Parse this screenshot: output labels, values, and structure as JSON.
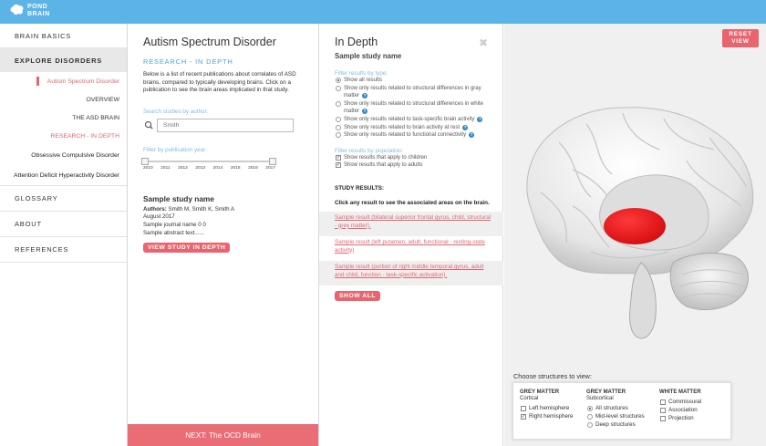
{
  "brand": {
    "logo_line1": "POND",
    "logo_line2": "BRAIN"
  },
  "sidebar": {
    "items": [
      {
        "label": "BRAIN BASICS"
      },
      {
        "label": "EXPLORE DISORDERS"
      }
    ],
    "sub_items": [
      {
        "label": "Autism Spectrum Disorder"
      },
      {
        "label": "OVERVIEW"
      },
      {
        "label": "THE ASD BRAIN"
      },
      {
        "label": "RESEARCH - IN DEPTH"
      }
    ],
    "disorders": [
      {
        "label": "Obsessive Compulsive Disorder"
      },
      {
        "label": "Attention Deficit Hyperactivity Disorder"
      }
    ],
    "bottom_items": [
      {
        "label": "GLOSSARY"
      },
      {
        "label": "ABOUT"
      },
      {
        "label": "REFERENCES"
      }
    ]
  },
  "research": {
    "title": "Autism Spectrum Disorder",
    "subtitle": "RESEARCH - IN DEPTH",
    "description": "Below is a list of recent publications about correlates of ASD brains, compared to typically developing brains. Click on a publication to see the brain areas implicated in that study.",
    "search_label": "Search studies by author:",
    "search_value": "Smith",
    "year_label": "Filter by publication year:",
    "years": [
      "2010",
      "2011",
      "2012",
      "2013",
      "2014",
      "2015",
      "2016",
      "2017"
    ],
    "year_range": [
      "2010",
      "2017"
    ],
    "study": {
      "title": "Sample study name",
      "authors_label": "Authors:",
      "authors": "Smith M, Smith K, Smith A",
      "date": "August 2017",
      "journal": "Sample journal name 0 0",
      "abstract": "Sample abstract text......",
      "button": "VIEW STUDY IN DEPTH"
    },
    "next_label": "NEXT: The OCD Brain"
  },
  "in_depth": {
    "title": "In Depth",
    "close_glyph": "✖",
    "study_name": "Sample study name",
    "filter_type_label": "Filter results by type:",
    "type_options": [
      {
        "label": "Show all results",
        "selected": true,
        "help": false
      },
      {
        "label": "Show only results related to structural differences in gray matter",
        "selected": false,
        "help": true
      },
      {
        "label": "Show only results related to structural differences in white matter",
        "selected": false,
        "help": true
      },
      {
        "label": "Show only results related to task-specific brain activity",
        "selected": false,
        "help": true
      },
      {
        "label": "Show only results related to brain activity at rest",
        "selected": false,
        "help": true
      },
      {
        "label": "Show only results related to functional connectivity",
        "selected": false,
        "help": true
      }
    ],
    "filter_population_label": "Filter results by population:",
    "population_options": [
      {
        "label": "Show results that apply to children",
        "checked": true
      },
      {
        "label": "Show results that apply to adults",
        "checked": true
      }
    ],
    "results_heading": "STUDY RESULTS:",
    "results_note": "Click any result to see the associated areas on the brain.",
    "results": [
      "Sample result (bilateral superior frontal gyrus, child, structural - grey matter).",
      "Sample result (left putamen, adult, functional - resting-state activity)",
      "Sample result (portion of right middle temporal gyrus, adult and child, function - task-specific activation)."
    ],
    "show_all": "SHOW ALL"
  },
  "brain_view": {
    "reset_label": "RESET VIEW",
    "highlight_color": "#e60f14",
    "choose_label": "Choose structures to view:",
    "groups": [
      {
        "title": "GREY MATTER",
        "subtitle": "Cortical",
        "control": "checkbox",
        "items": [
          {
            "label": "Left hemisphere",
            "on": false
          },
          {
            "label": "Right hemisphere",
            "on": true
          }
        ]
      },
      {
        "title": "GREY MATTER",
        "subtitle": "Subcortical",
        "control": "radio",
        "items": [
          {
            "label": "All structures",
            "on": true
          },
          {
            "label": "Mid-level structures",
            "on": false
          },
          {
            "label": "Deep structures",
            "on": false
          }
        ]
      },
      {
        "title": "WHITE MATTER",
        "subtitle": "",
        "control": "checkbox",
        "items": [
          {
            "label": "Commissural",
            "on": false
          },
          {
            "label": "Association",
            "on": false
          },
          {
            "label": "Projection",
            "on": false
          }
        ]
      }
    ]
  },
  "colors": {
    "topbar": "#5cb3e6",
    "accent_pink": "#e8656f",
    "link_blue": "#4aa6d4"
  }
}
